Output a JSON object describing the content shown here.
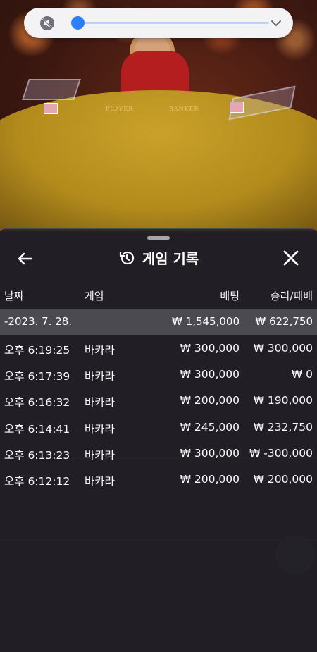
{
  "video_control": {
    "mute_icon": "speaker-off-icon",
    "volume_level": 0.02,
    "expand_icon": "chevron-down-icon"
  },
  "background_table": {
    "player_label": "PLAYER",
    "banker_label": "BANKER"
  },
  "history": {
    "title": "게임 기록",
    "title_icon": "history-icon",
    "back_icon": "arrow-left-icon",
    "close_icon": "close-icon",
    "columns": {
      "date": "날짜",
      "game": "게임",
      "bet": "베팅",
      "win_loss": "승리/패배"
    },
    "day_summary": {
      "date": "-2023. 7. 28.",
      "bet": "₩ 1,545,000",
      "win_loss": "₩ 622,750"
    },
    "rows": [
      {
        "time": "오후 6:19:25",
        "game": "바카라",
        "bet": "₩ 300,000",
        "win_loss": "₩ 300,000"
      },
      {
        "time": "오후 6:17:39",
        "game": "바카라",
        "bet": "₩ 300,000",
        "win_loss": "₩ 0"
      },
      {
        "time": "오후 6:16:32",
        "game": "바카라",
        "bet": "₩ 200,000",
        "win_loss": "₩ 190,000"
      },
      {
        "time": "오후 6:14:41",
        "game": "바카라",
        "bet": "₩ 245,000",
        "win_loss": "₩ 232,750"
      },
      {
        "time": "오후 6:13:23",
        "game": "바카라",
        "bet": "₩ 300,000",
        "win_loss": "₩ -300,000"
      },
      {
        "time": "오후 6:12:12",
        "game": "바카라",
        "bet": "₩ 200,000",
        "win_loss": "₩ 200,000"
      }
    ]
  },
  "colors": {
    "accent": "#2d7ff9",
    "panel_bg": "#222126",
    "day_row_bg": "#4a4a50"
  }
}
